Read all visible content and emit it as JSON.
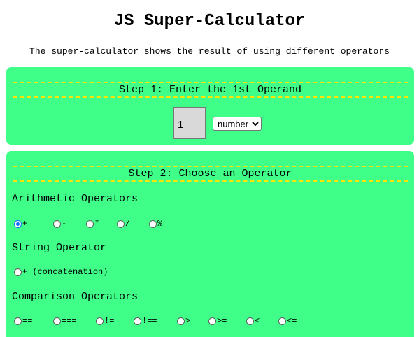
{
  "page": {
    "title": "JS Super-Calculator",
    "subtitle": "The super-calculator shows the result of using different operators"
  },
  "step1": {
    "heading": "Step 1: Enter the 1st Operand",
    "operand_value": "1",
    "type_selected": "number"
  },
  "step2": {
    "heading": "Step 2: Choose an Operator",
    "groups": [
      {
        "label": "Arithmetic Operators",
        "options": [
          "+",
          "-",
          "*",
          "/",
          "%"
        ],
        "selected": "+"
      },
      {
        "label": "String Operator",
        "options": [
          "+ (concatenation)"
        ]
      },
      {
        "label": "Comparison Operators",
        "options": [
          "==",
          "===",
          "!=",
          "!==",
          ">",
          ">=",
          "<",
          "<="
        ]
      }
    ]
  },
  "colors": {
    "panel_bg": "#40ff88",
    "dash": "#ffe600",
    "radio_selected": "#0a6cff"
  }
}
